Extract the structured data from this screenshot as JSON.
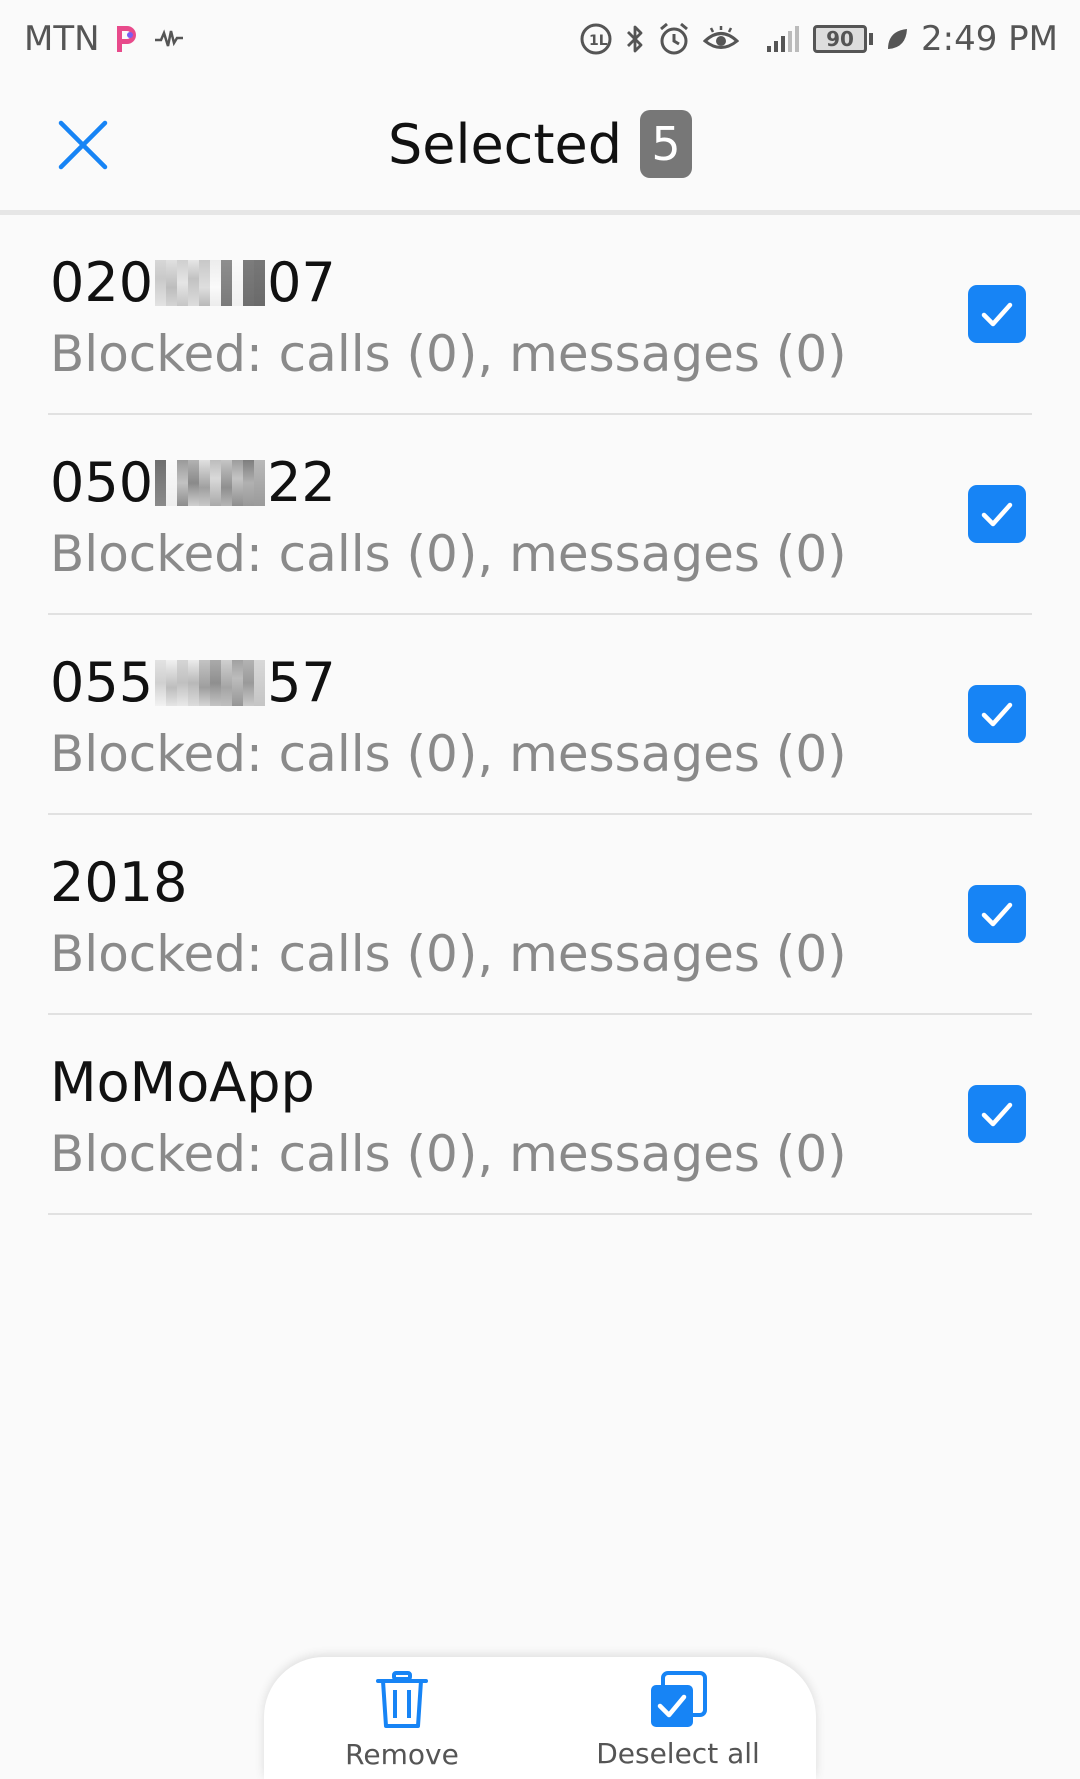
{
  "status_bar": {
    "carrier": "MTN",
    "battery": "90",
    "time": "2:49 PM"
  },
  "header": {
    "title": "Selected",
    "count": "5"
  },
  "list": {
    "items": [
      {
        "name_start": "020",
        "name_end": "07",
        "redacted": true,
        "subtitle": "Blocked: calls (0), messages (0)",
        "checked": true
      },
      {
        "name_start": "050",
        "name_end": "22",
        "redacted": true,
        "subtitle": "Blocked: calls (0), messages (0)",
        "checked": true
      },
      {
        "name_start": "055",
        "name_end": "57",
        "redacted": true,
        "subtitle": "Blocked: calls (0), messages (0)",
        "checked": true
      },
      {
        "name_start": "2018",
        "name_end": "",
        "redacted": false,
        "subtitle": "Blocked: calls (0), messages (0)",
        "checked": true
      },
      {
        "name_start": "MoMoApp",
        "name_end": "",
        "redacted": false,
        "subtitle": "Blocked: calls (0), messages (0)",
        "checked": true
      }
    ]
  },
  "bottom_bar": {
    "remove_label": "Remove",
    "deselect_label": "Deselect all"
  },
  "colors": {
    "accent": "#1784f5",
    "badge": "#777777"
  }
}
